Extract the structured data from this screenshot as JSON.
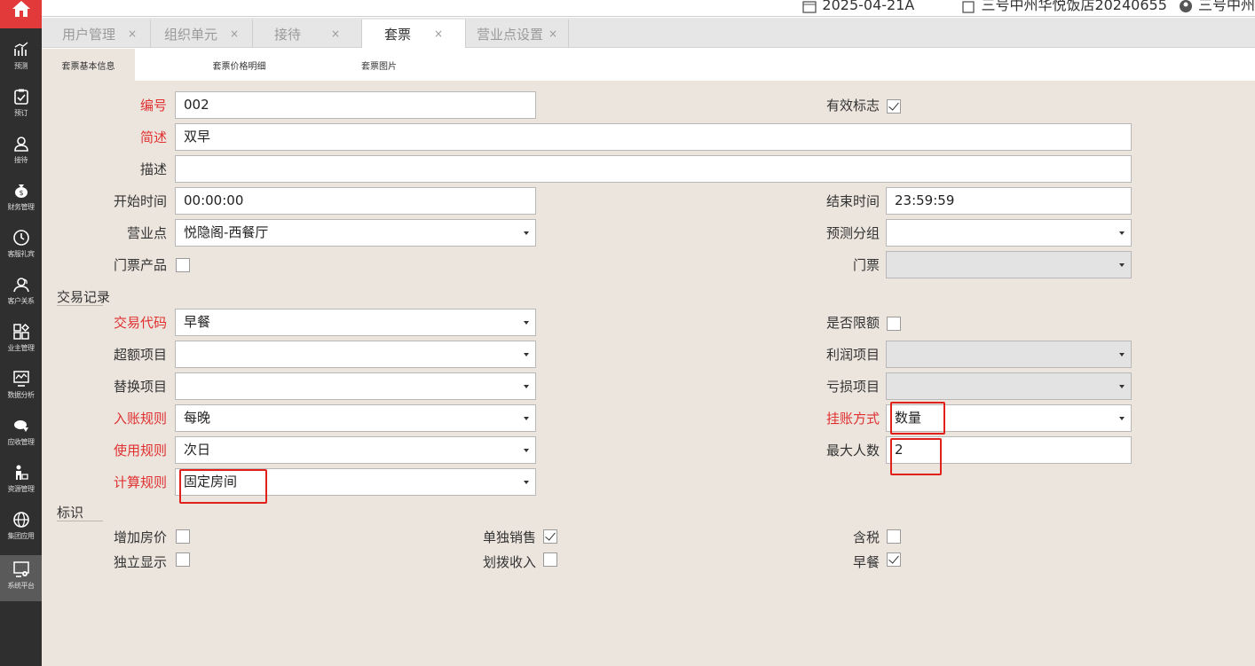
{
  "topbar": {
    "date": "2025-04-21A",
    "hotel": "三号中州华悦饭店20240655",
    "user": "三号中州"
  },
  "sidebar": {
    "home_icon": "home-icon",
    "items": [
      {
        "label": "预测",
        "icon": "forecast-icon"
      },
      {
        "label": "预订",
        "icon": "clipboard-check-icon"
      },
      {
        "label": "接待",
        "icon": "user-icon"
      },
      {
        "label": "财务管理",
        "icon": "money-bag-icon"
      },
      {
        "label": "客服礼宾",
        "icon": "clock-icon"
      },
      {
        "label": "客户关系",
        "icon": "users-icon"
      },
      {
        "label": "业主管理",
        "icon": "grid-icon"
      },
      {
        "label": "数据分析",
        "icon": "monitor-chart-icon"
      },
      {
        "label": "应收管理",
        "icon": "receivable-icon"
      },
      {
        "label": "资源管理",
        "icon": "person-cart-icon"
      },
      {
        "label": "集团应用",
        "icon": "globe-icon"
      },
      {
        "label": "系统平台",
        "icon": "system-gear-icon"
      }
    ]
  },
  "tabs": [
    {
      "label": "用户管理",
      "close": "×"
    },
    {
      "label": "组织单元",
      "close": "×"
    },
    {
      "label": "接待",
      "close": "×"
    },
    {
      "label": "套票",
      "close": "×"
    },
    {
      "label": "营业点设置",
      "close": "×"
    }
  ],
  "subtabs": [
    "套票基本信息",
    "套票价格明细",
    "套票图片"
  ],
  "form": {
    "code": {
      "label": "编号",
      "value": "002"
    },
    "valid_flag": {
      "label": "有效标志",
      "checked": true
    },
    "brief": {
      "label": "简述",
      "value": "双早"
    },
    "desc": {
      "label": "描述",
      "value": ""
    },
    "start_time": {
      "label": "开始时间",
      "value": "00:00:00"
    },
    "end_time": {
      "label": "结束时间",
      "value": "23:59:59"
    },
    "outlet": {
      "label": "营业点",
      "value": "悦隐阁-西餐厅"
    },
    "forecast_group": {
      "label": "预测分组",
      "value": ""
    },
    "ticket_product": {
      "label": "门票产品",
      "checked": false
    },
    "ticket": {
      "label": "门票",
      "value": ""
    }
  },
  "transaction": {
    "section_title": "交易记录",
    "trans_code": {
      "label": "交易代码",
      "value": "早餐"
    },
    "limit": {
      "label": "是否限额",
      "checked": false
    },
    "over_item": {
      "label": "超额项目",
      "value": ""
    },
    "profit_item": {
      "label": "利润项目",
      "value": ""
    },
    "replace_item": {
      "label": "替换项目",
      "value": ""
    },
    "loss_item": {
      "label": "亏损项目",
      "value": ""
    },
    "post_rule": {
      "label": "入账规则",
      "value": "每晚"
    },
    "charge_method": {
      "label": "挂账方式",
      "value": "数量"
    },
    "use_rule": {
      "label": "使用规则",
      "value": "次日"
    },
    "max_persons": {
      "label": "最大人数",
      "value": "2"
    },
    "calc_rule": {
      "label": "计算规则",
      "value": "固定房间"
    }
  },
  "flags": {
    "section_title": "标识",
    "add_room_price": {
      "label": "增加房价",
      "checked": false
    },
    "sold_separately": {
      "label": "单独销售",
      "checked": true
    },
    "tax_included": {
      "label": "含税",
      "checked": false
    },
    "display_separately": {
      "label": "独立显示",
      "checked": false
    },
    "allocated_income": {
      "label": "划拨收入",
      "checked": false
    },
    "breakfast": {
      "label": "早餐",
      "checked": true
    }
  },
  "colors": {
    "required_label": "#e03030",
    "highlight": "#e0201a",
    "content_bg": "#ece5de",
    "sidebar_bg": "#2f2f2f",
    "home_bg": "#e23a3a"
  }
}
